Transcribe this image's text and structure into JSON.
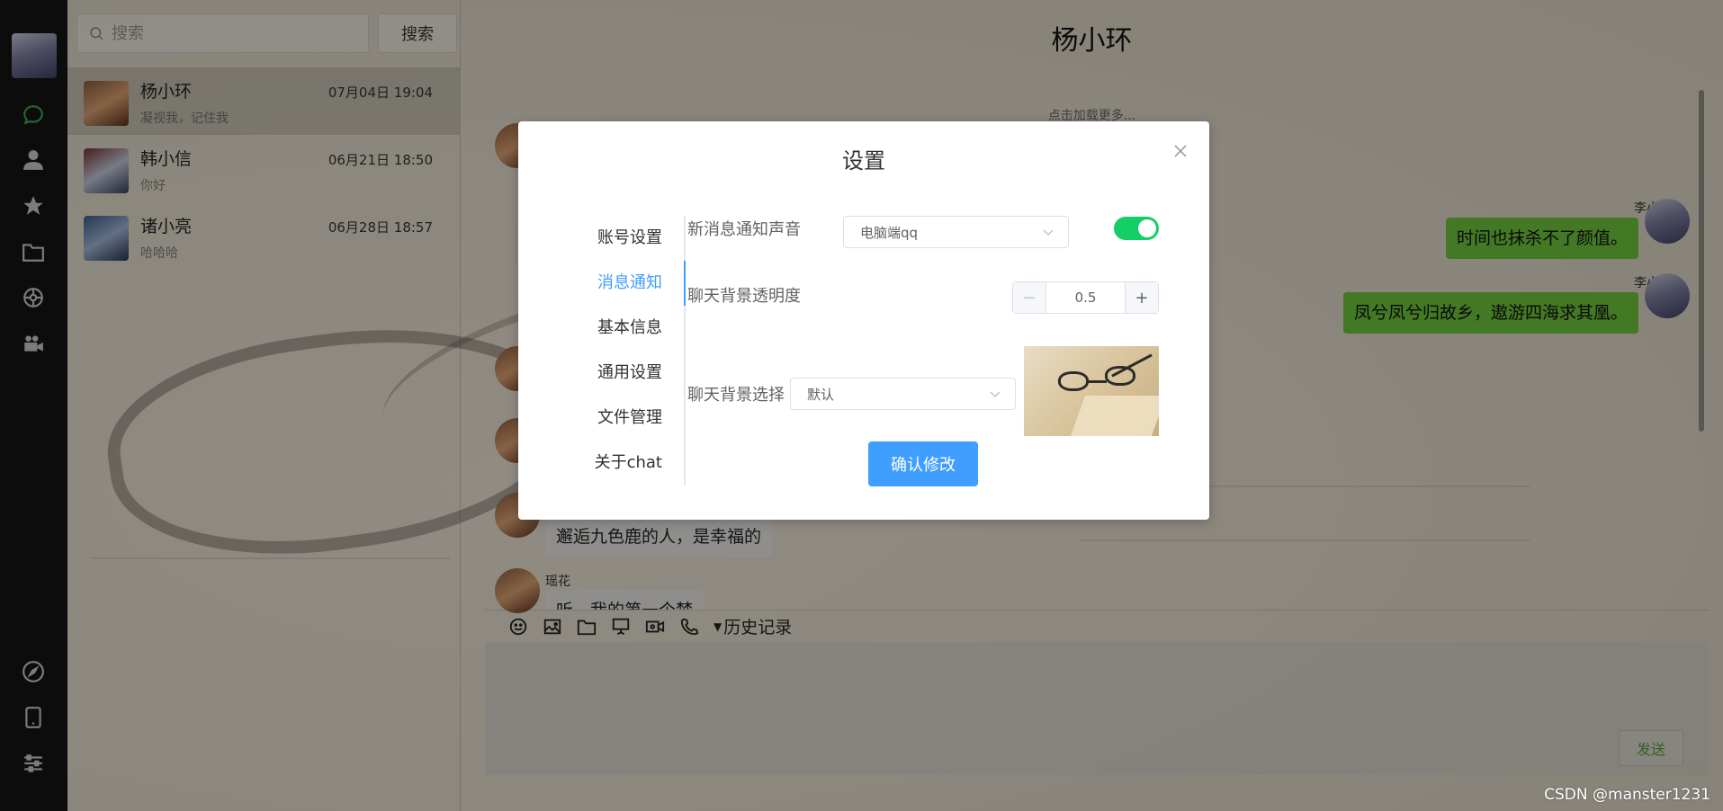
{
  "nav": {
    "icons": [
      "chat-icon",
      "contacts-icon",
      "star-icon",
      "folder-icon",
      "aperture-icon",
      "video-camera-icon",
      "compass-icon",
      "mobile-icon",
      "sliders-icon"
    ],
    "active_color": "#3aa54d"
  },
  "search": {
    "placeholder": "搜索",
    "button_label": "搜索"
  },
  "contacts": [
    {
      "name": "杨小环",
      "time": "07月04日 19:04",
      "preview": "凝视我，记住我"
    },
    {
      "name": "韩小信",
      "time": "06月21日 18:50",
      "preview": "你好"
    },
    {
      "name": "诸小亮",
      "time": "06月28日 18:57",
      "preview": "哈哈哈"
    }
  ],
  "chat": {
    "title": "杨小环",
    "load_more": "点击加载更多...",
    "messages": [
      {
        "sender": "李小白",
        "text": "时间也抹杀不了颜值。",
        "direction": "out"
      },
      {
        "sender": "李小白",
        "text": "凤兮凤兮归故乡，遨游四海求其凰。",
        "direction": "out"
      },
      {
        "sender": "",
        "text": "邂逅九色鹿的人，是幸福的",
        "direction": "in"
      },
      {
        "sender": "瑶花",
        "text": "听，我的第一个梦",
        "direction": "in"
      }
    ],
    "toolbar_icons": [
      "emoji-icon",
      "image-icon",
      "folder-icon",
      "screen-share-icon",
      "video-call-icon",
      "phone-icon"
    ],
    "history_label": "历史记录",
    "send_label": "发送"
  },
  "watermark": "CSDN @manster1231",
  "settings_modal": {
    "title": "设置",
    "tabs": [
      "账号设置",
      "消息通知",
      "基本信息",
      "通用设置",
      "文件管理",
      "关于chat"
    ],
    "active_tab": "消息通知",
    "sound_label": "新消息通知声音",
    "sound_value": "电脑端qq",
    "sound_enabled": true,
    "opacity_label": "聊天背景透明度",
    "opacity_value": "0.5",
    "bg_label": "聊天背景选择",
    "bg_value": "默认",
    "confirm_label": "确认修改",
    "accent_color": "#409eff",
    "toggle_color": "#13ce66"
  }
}
